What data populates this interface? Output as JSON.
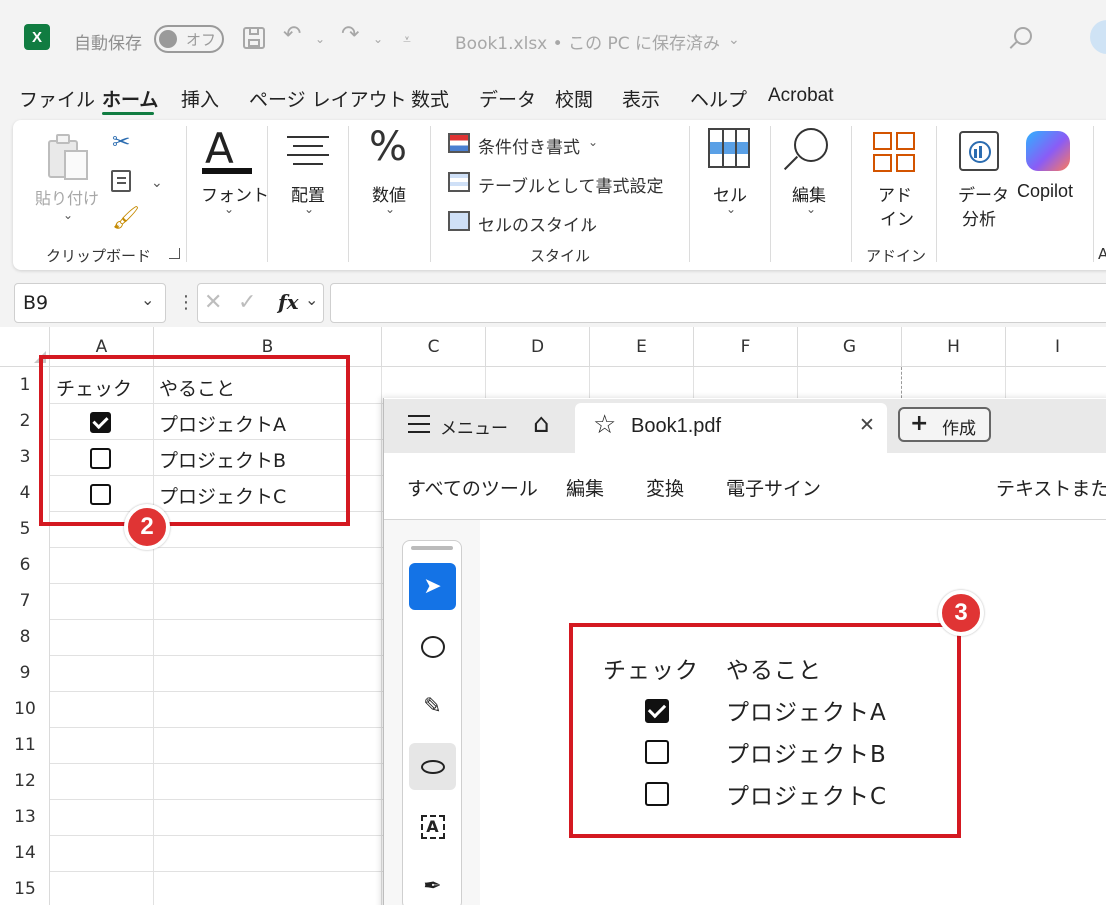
{
  "titlebar": {
    "app_icon": "X",
    "autosave_label": "自動保存",
    "autosave_state": "オフ",
    "filename": "Book1.xlsx • この PC に保存済み",
    "icons": [
      "save-icon",
      "undo-icon",
      "redo-icon",
      "customize-icon",
      "search-icon",
      "copilot-avatar-icon"
    ]
  },
  "menu": {
    "tabs": [
      "ファイル",
      "ホーム",
      "挿入",
      "ページ レイアウト",
      "数式",
      "データ",
      "校閲",
      "表示",
      "ヘルプ",
      "Acrobat"
    ],
    "active": "ホーム"
  },
  "ribbon": {
    "paste_label": "貼り付け",
    "clipboard_group": "クリップボード",
    "font_label": "フォント",
    "align_label": "配置",
    "number_label": "数値",
    "cond_format": "条件付き書式",
    "table_format": "テーブルとして書式設定",
    "cell_style": "セルのスタイル",
    "style_group": "スタイル",
    "cells_label": "セル",
    "edit_label": "編集",
    "addin_label_1": "アド",
    "addin_label_2": "イン",
    "addin_group": "アドイン",
    "data_analysis_1": "データ",
    "data_analysis_2": "分析",
    "copilot_label": "Copilot",
    "cut_off_group": "A"
  },
  "formula_bar": {
    "name_box": "B9",
    "fx": "fx"
  },
  "sheet": {
    "columns": [
      "A",
      "B",
      "C",
      "D",
      "E",
      "F",
      "G",
      "H",
      "I"
    ],
    "rows": [
      "1",
      "2",
      "3",
      "4",
      "5",
      "6",
      "7",
      "8",
      "9",
      "10",
      "11",
      "12",
      "13",
      "14",
      "15"
    ],
    "cells": {
      "a1": "チェック",
      "b1": "やること",
      "b2": "プロジェクトA",
      "b3": "プロジェクトB",
      "b4": "プロジェクトC"
    },
    "checks": [
      true,
      false,
      false
    ]
  },
  "badges": {
    "excel": "2",
    "pdf": "3"
  },
  "acrobat": {
    "menu_label": "メニュー",
    "tab_title": "Book1.pdf",
    "create_label": "作成",
    "toolbar": [
      "すべてのツール",
      "編集",
      "変換",
      "電子サイン"
    ],
    "search_partial": "テキストまたに",
    "pdf": {
      "col1": "チェック",
      "col2": "やること",
      "items": [
        "プロジェクトA",
        "プロジェクトB",
        "プロジェクトC"
      ],
      "checks": [
        true,
        false,
        false
      ]
    }
  },
  "colors": {
    "excel_green": "#107c41",
    "highlight_red": "#d41921",
    "badge_red": "#e03434",
    "acrobat_blue": "#1473e6"
  }
}
